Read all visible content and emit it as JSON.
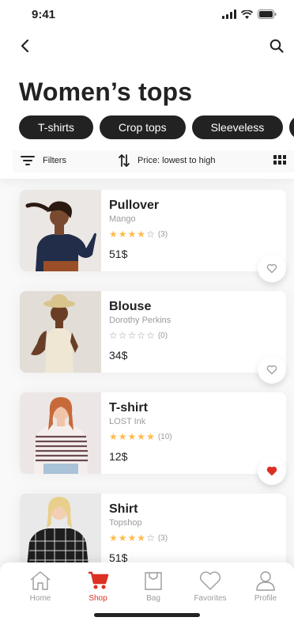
{
  "status_bar": {
    "time": "9:41"
  },
  "header": {
    "title": "Women’s tops"
  },
  "categories": [
    "T-shirts",
    "Crop tops",
    "Sleeveless",
    ""
  ],
  "filter_bar": {
    "filters_label": "Filters",
    "sort_label": "Price: lowest to high"
  },
  "products": [
    {
      "name": "Pullover",
      "brand": "Mango",
      "rating": 4,
      "rating_count": "(3)",
      "price": "51$",
      "favorite": false
    },
    {
      "name": "Blouse",
      "brand": "Dorothy Perkins",
      "rating": 0,
      "rating_count": "(0)",
      "price": "34$",
      "favorite": false
    },
    {
      "name": "T-shirt",
      "brand": "LOST Ink",
      "rating": 5,
      "rating_count": "(10)",
      "price": "12$",
      "favorite": true
    },
    {
      "name": "Shirt",
      "brand": "Topshop",
      "rating": 4,
      "rating_count": "(3)",
      "price": "51$",
      "favorite": false
    }
  ],
  "bottom_nav": [
    {
      "label": "Home",
      "icon": "home-icon",
      "active": false
    },
    {
      "label": "Shop",
      "icon": "cart-icon",
      "active": true
    },
    {
      "label": "Bag",
      "icon": "bag-icon",
      "active": false
    },
    {
      "label": "Favorites",
      "icon": "heart-icon",
      "active": false
    },
    {
      "label": "Profile",
      "icon": "profile-icon",
      "active": false
    }
  ],
  "colors": {
    "primary": "#db3022",
    "dark": "#222222",
    "gray": "#9b9b9b",
    "star": "#ffba49"
  }
}
